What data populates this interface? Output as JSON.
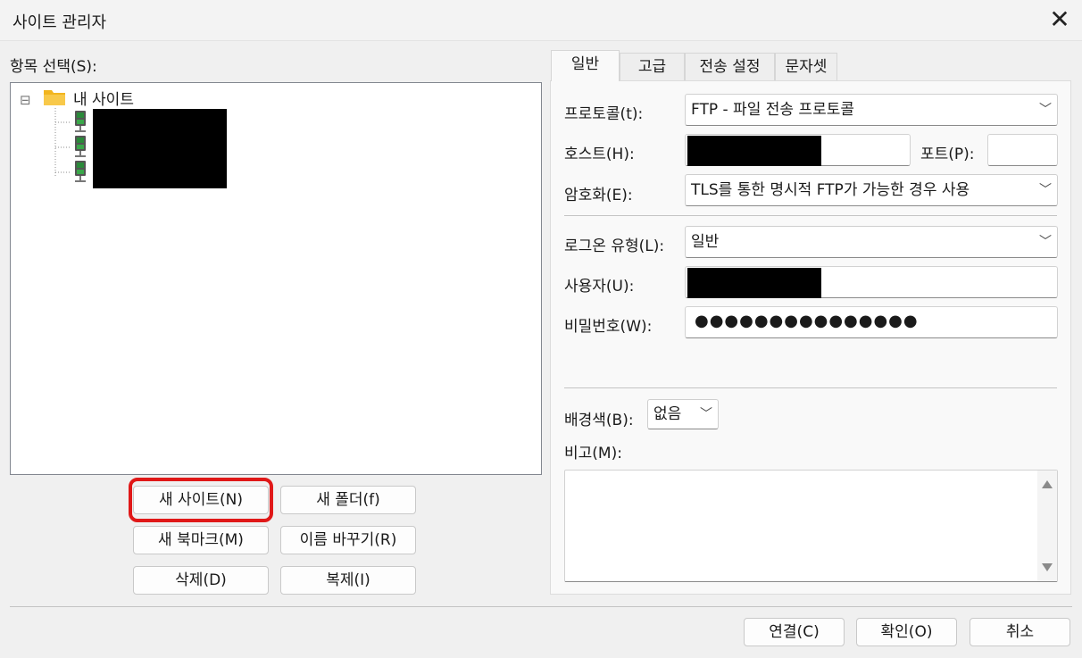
{
  "window": {
    "title": "사이트 관리자",
    "close_glyph": "✕"
  },
  "tree_panel": {
    "label": "항목 선택(S):",
    "root_label": "내 사이트",
    "expander": "⊟"
  },
  "site_buttons": {
    "new_site": "새 사이트(N)",
    "new_folder": "새 폴더(f)",
    "new_bookmark": "새 북마크(M)",
    "rename": "이름 바꾸기(R)",
    "delete": "삭제(D)",
    "duplicate": "복제(I)"
  },
  "tabs": [
    "일반",
    "고급",
    "전송 설정",
    "문자셋"
  ],
  "general": {
    "protocol_label": "프로토콜(t):",
    "protocol_value": "FTP - 파일 전송 프로토콜",
    "host_label": "호스트(H):",
    "port_label": "포트(P):",
    "port_value": "",
    "encryption_label": "암호화(E):",
    "encryption_value": "TLS를 통한 명시적 FTP가 가능한 경우 사용",
    "logon_label": "로그온 유형(L):",
    "logon_value": "일반",
    "user_label": "사용자(U):",
    "password_label": "비밀번호(W):",
    "password_value": "●●●●●●●●●●●●●●●",
    "bgcolor_label": "배경색(B):",
    "bgcolor_value": "없음",
    "comments_label": "비고(M):",
    "dropdown_glyph": "﹀"
  },
  "footer": {
    "connect": "연결(C)",
    "ok": "확인(O)",
    "cancel": "취소"
  },
  "colors": {
    "highlight_border": "#e01818",
    "folder": "#f2b51f",
    "server_icon": "#2a8a3a"
  }
}
